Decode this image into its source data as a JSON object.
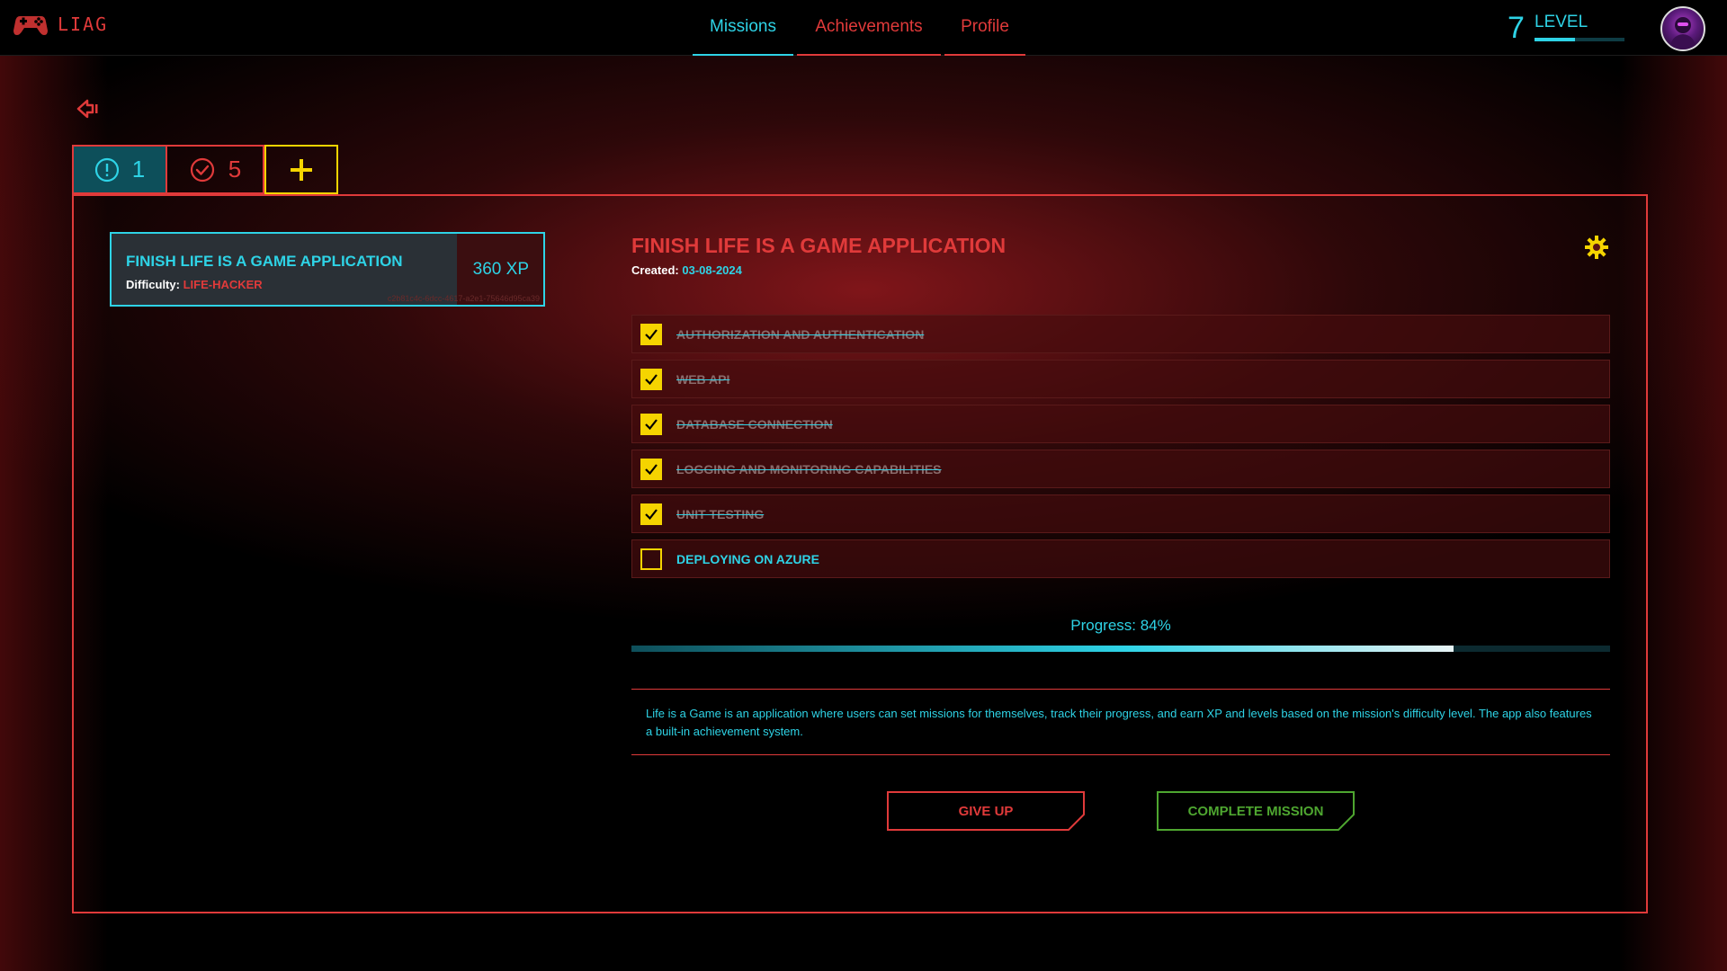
{
  "header": {
    "logo_text": "LIAG",
    "nav": [
      {
        "label": "Missions",
        "active": true
      },
      {
        "label": "Achievements",
        "active": false
      },
      {
        "label": "Profile",
        "active": false
      }
    ],
    "level": {
      "number": "7",
      "label": "LEVEL",
      "progress_fraction": 0.45
    }
  },
  "filters": {
    "active_count": "1",
    "completed_count": "5"
  },
  "mission_card": {
    "title": "FINISH LIFE IS A GAME APPLICATION",
    "difficulty_label": "Difficulty:",
    "difficulty_value": "LIFE-HACKER",
    "xp": "360 XP",
    "id": "c2b81c4c-6dcc-4617-a2e1-75646d95ca39"
  },
  "detail": {
    "title": "FINISH LIFE IS A GAME APPLICATION",
    "created_label": "Created:",
    "created_date": "03-08-2024",
    "tasks": [
      {
        "label": "AUTHORIZATION AND AUTHENTICATION",
        "done": true
      },
      {
        "label": "WEB API",
        "done": true
      },
      {
        "label": "DATABASE CONNECTION",
        "done": true
      },
      {
        "label": "LOGGING AND MONITORING CAPABILITIES",
        "done": true
      },
      {
        "label": "UNIT TESTING",
        "done": true
      },
      {
        "label": "DEPLOYING ON AZURE",
        "done": false
      }
    ],
    "progress_text": "Progress: 84%",
    "progress_fraction": 0.84,
    "description": "Life is a Game is an application where users can set missions for themselves, track their progress, and earn XP and levels based on the mission's difficulty level. The app also features a built-in achievement system.",
    "give_up_label": "GIVE UP",
    "complete_label": "COMPLETE MISSION"
  },
  "colors": {
    "accent_red": "#e03a3a",
    "accent_cyan": "#2ed3e6",
    "accent_yellow": "#f5d400",
    "accent_green": "#4ea630"
  }
}
